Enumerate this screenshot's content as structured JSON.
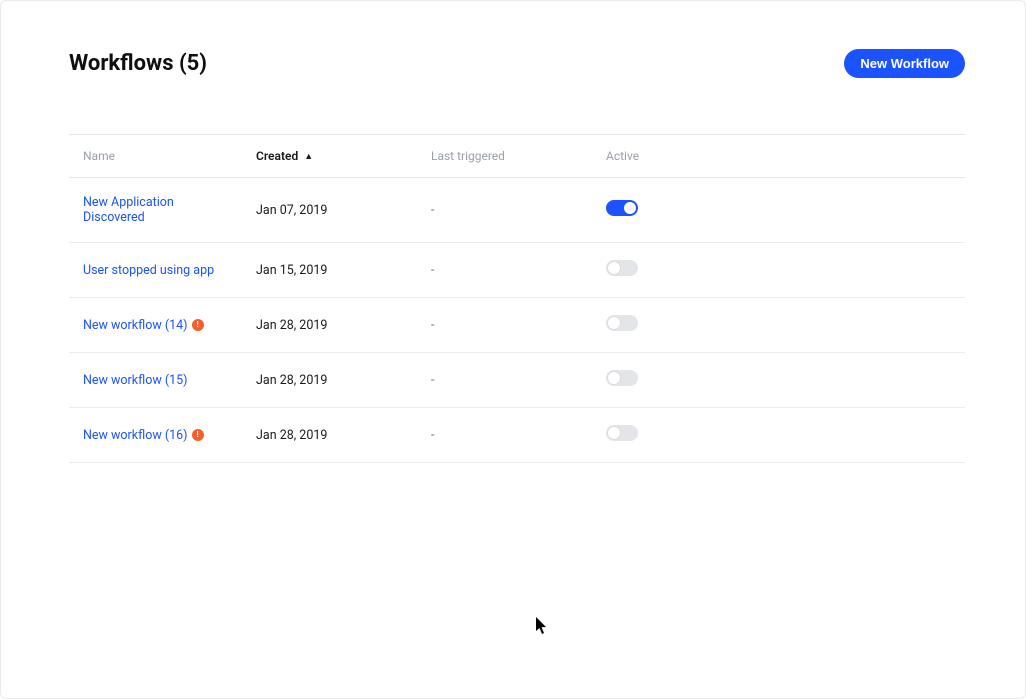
{
  "header": {
    "title": "Workflows (5)",
    "new_button_label": "New Workflow"
  },
  "columns": {
    "name": "Name",
    "created": "Created",
    "last_triggered": "Last triggered",
    "active": "Active",
    "sorted_column": "created",
    "sort_direction_glyph": "▲"
  },
  "rows": [
    {
      "name": "New Application Discovered",
      "created": "Jan 07, 2019",
      "last_triggered": "-",
      "active": true,
      "has_warning": false
    },
    {
      "name": "User stopped using app",
      "created": "Jan 15, 2019",
      "last_triggered": "-",
      "active": false,
      "has_warning": false
    },
    {
      "name": "New workflow (14)",
      "created": "Jan 28, 2019",
      "last_triggered": "-",
      "active": false,
      "has_warning": true
    },
    {
      "name": "New workflow (15)",
      "created": "Jan 28, 2019",
      "last_triggered": "-",
      "active": false,
      "has_warning": false
    },
    {
      "name": "New workflow (16)",
      "created": "Jan 28, 2019",
      "last_triggered": "-",
      "active": false,
      "has_warning": true
    }
  ],
  "warning_glyph": "!"
}
